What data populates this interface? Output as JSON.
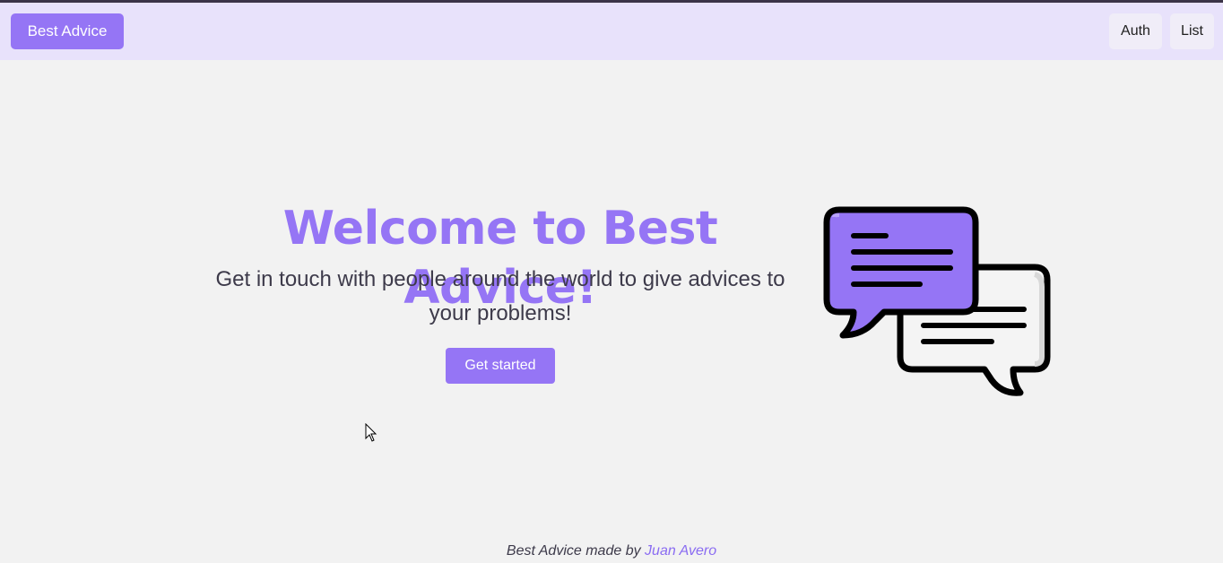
{
  "navbar": {
    "brand_label": "Best Advice",
    "auth_label": "Auth",
    "list_label": "List"
  },
  "hero": {
    "title": "Welcome to Best Advice!",
    "subtitle": "Get in touch with people around the world to give advices to your problems!",
    "cta_label": "Get started",
    "illustration_icon": "chat-bubbles-icon"
  },
  "footer": {
    "prefix": "Best Advice made by ",
    "author": "Juan Avero"
  },
  "colors": {
    "accent": "#9575f5",
    "navbar_bg": "#e8e2fb",
    "page_bg": "#f2f2f2",
    "text": "#3d3a4a"
  }
}
